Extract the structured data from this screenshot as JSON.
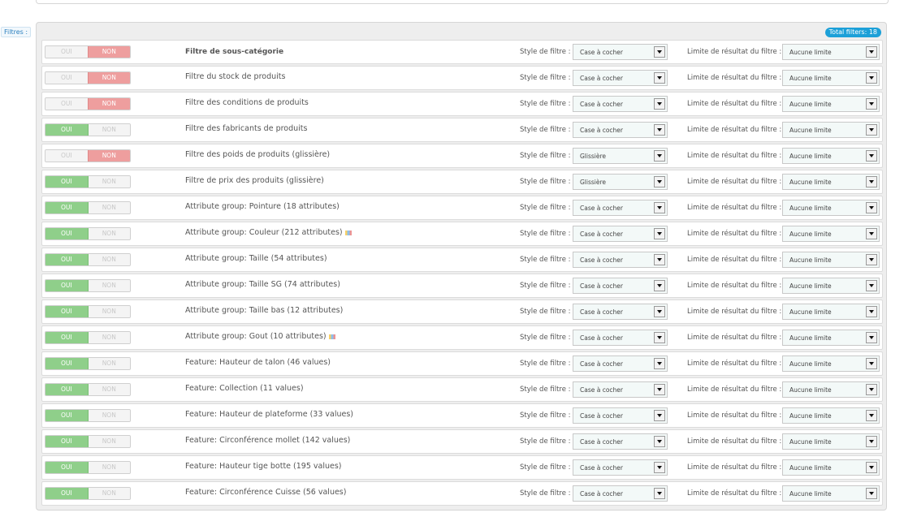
{
  "sidebar_label": "Filtres :",
  "total_badge": "Total filters: 18",
  "labels": {
    "style": "Style de filtre :",
    "limit": "Limite de résultat du filtre :",
    "oui": "OUI",
    "non": "NON"
  },
  "colors": {
    "active_yes": "#8fcf8a",
    "active_no": "#ee9e9e",
    "badge": "#1ca0d8"
  },
  "filters": [
    {
      "name": "Filtre de sous-catégorie",
      "enabled": false,
      "style": "Case à cocher",
      "limit": "Aucune limite",
      "bold": true,
      "icon": ""
    },
    {
      "name": "Filtre du stock de produits",
      "enabled": false,
      "style": "Case à cocher",
      "limit": "Aucune limite",
      "icon": ""
    },
    {
      "name": "Filtre des conditions de produits",
      "enabled": false,
      "style": "Case à cocher",
      "limit": "Aucune limite",
      "icon": ""
    },
    {
      "name": "Filtre des fabricants de produits",
      "enabled": true,
      "style": "Case à cocher",
      "limit": "Aucune limite",
      "icon": ""
    },
    {
      "name": "Filtre des poids de produits (glissière)",
      "enabled": false,
      "style": "Glissière",
      "limit": "Aucune limite",
      "icon": ""
    },
    {
      "name": "Filtre de prix des produits (glissière)",
      "enabled": true,
      "style": "Glissière",
      "limit": "Aucune limite",
      "icon": ""
    },
    {
      "name": "Attribute group: Pointure (18 attributes)",
      "enabled": true,
      "style": "Case à cocher",
      "limit": "Aucune limite",
      "icon": ""
    },
    {
      "name": "Attribute group: Couleur (212 attributes)",
      "enabled": true,
      "style": "Case à cocher",
      "limit": "Aucune limite",
      "icon": "color-group-icon"
    },
    {
      "name": "Attribute group: Taille (54 attributes)",
      "enabled": true,
      "style": "Case à cocher",
      "limit": "Aucune limite",
      "icon": ""
    },
    {
      "name": "Attribute group: Taille SG (74 attributes)",
      "enabled": true,
      "style": "Case à cocher",
      "limit": "Aucune limite",
      "icon": ""
    },
    {
      "name": "Attribute group: Taille bas (12 attributes)",
      "enabled": true,
      "style": "Case à cocher",
      "limit": "Aucune limite",
      "icon": ""
    },
    {
      "name": "Attribute group: Gout (10 attributes)",
      "enabled": true,
      "style": "Case à cocher",
      "limit": "Aucune limite",
      "icon": "color-group-icon"
    },
    {
      "name": "Feature: Hauteur de talon (46 values)",
      "enabled": true,
      "style": "Case à cocher",
      "limit": "Aucune limite",
      "icon": ""
    },
    {
      "name": "Feature: Collection (11 values)",
      "enabled": true,
      "style": "Case à cocher",
      "limit": "Aucune limite",
      "icon": ""
    },
    {
      "name": "Feature: Hauteur de plateforme (33 values)",
      "enabled": true,
      "style": "Case à cocher",
      "limit": "Aucune limite",
      "icon": ""
    },
    {
      "name": "Feature: Circonférence mollet (142 values)",
      "enabled": true,
      "style": "Case à cocher",
      "limit": "Aucune limite",
      "icon": ""
    },
    {
      "name": "Feature: Hauteur tige botte (195 values)",
      "enabled": true,
      "style": "Case à cocher",
      "limit": "Aucune limite",
      "icon": ""
    },
    {
      "name": "Feature: Circonférence Cuisse (56 values)",
      "enabled": true,
      "style": "Case à cocher",
      "limit": "Aucune limite",
      "icon": ""
    }
  ]
}
